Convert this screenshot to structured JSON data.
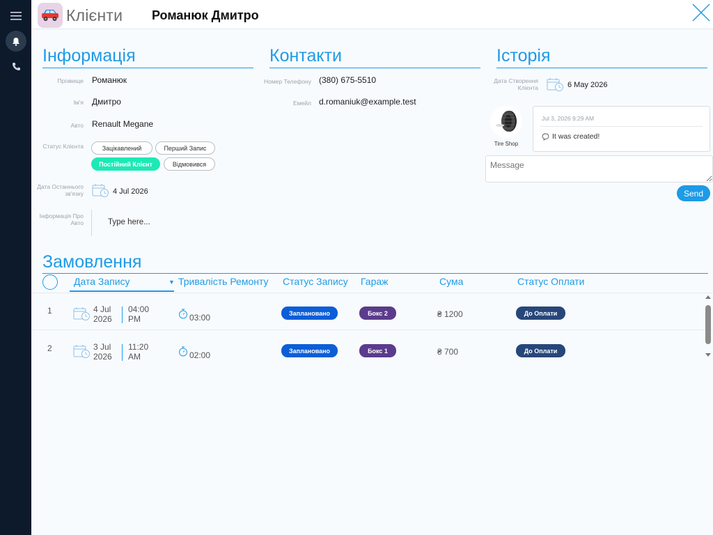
{
  "header": {
    "app_title": "Клієнти",
    "client_name": "Романюк Дмитро"
  },
  "info": {
    "title": "Інформація",
    "surname_label": "Прізвище",
    "surname": "Романюк",
    "name_label": "Ім'я",
    "name": "Дмитро",
    "car_label": "Авто",
    "car": "Renault Megane",
    "status_label": "Статус Клієнта",
    "statuses": [
      "Зацікавлений",
      "Перший Запис",
      "Постійний Клієнт",
      "Відмовився"
    ],
    "selected_status": "Постійний Клієнт",
    "last_contact_label_1": "Дата Останнього",
    "last_contact_label_2": "зв'язку",
    "last_contact": "4 Jul 2026",
    "car_info_label_1": "Інформація Про",
    "car_info_label_2": "Авто",
    "car_info_placeholder": "Type here..."
  },
  "contacts": {
    "title": "Контакти",
    "phone_label": "Номер Телефону",
    "phone": "(380) 675-5510",
    "email_label": "Емейл",
    "email": "d.romaniuk@example.test"
  },
  "history": {
    "title": "Історія",
    "created_label_1": "Дата Створення",
    "created_label_2": "Клієнта",
    "created": "6 May 2026",
    "author": "Tire Shop",
    "entry_time": "Jul 3, 2026 9:29 AM",
    "entry_text": "It was created!",
    "message_placeholder": "Message",
    "send_label": "Send"
  },
  "orders": {
    "title": "Замовлення",
    "columns": [
      "Дата Запису",
      "Тривалість Ремонту",
      "Статус Запису",
      "Гараж",
      "Сума",
      "Статус Оплати"
    ],
    "rows": [
      {
        "num": "1",
        "date_day": "4 Jul",
        "date_year": "2026",
        "time_hm": "04:00",
        "time_ampm": "PM",
        "duration": "03:00",
        "status": "Заплановано",
        "garage": "Бокс 2",
        "sum": "₴ 1200",
        "payment": "До Оплати"
      },
      {
        "num": "2",
        "date_day": "3 Jul",
        "date_year": "2026",
        "time_hm": "11:20",
        "time_ampm": "AM",
        "duration": "02:00",
        "status": "Заплановано",
        "garage": "Бокс 1",
        "sum": "₴ 700",
        "payment": "До Оплати"
      }
    ]
  },
  "icons": {
    "menu": "menu-icon",
    "bell": "bell-icon",
    "phone": "phone-icon",
    "close": "close-icon",
    "calendar": "calendar-clock-icon",
    "stopwatch": "stopwatch-icon",
    "comment": "comment-icon"
  },
  "colors": {
    "accent": "#1e9be6",
    "rail": "#0c1a2b",
    "active_status": "#1de9b6",
    "status_badge": "#0b5ed7",
    "garage_badge": "#5b3b8c",
    "payment_badge": "#27477a"
  }
}
